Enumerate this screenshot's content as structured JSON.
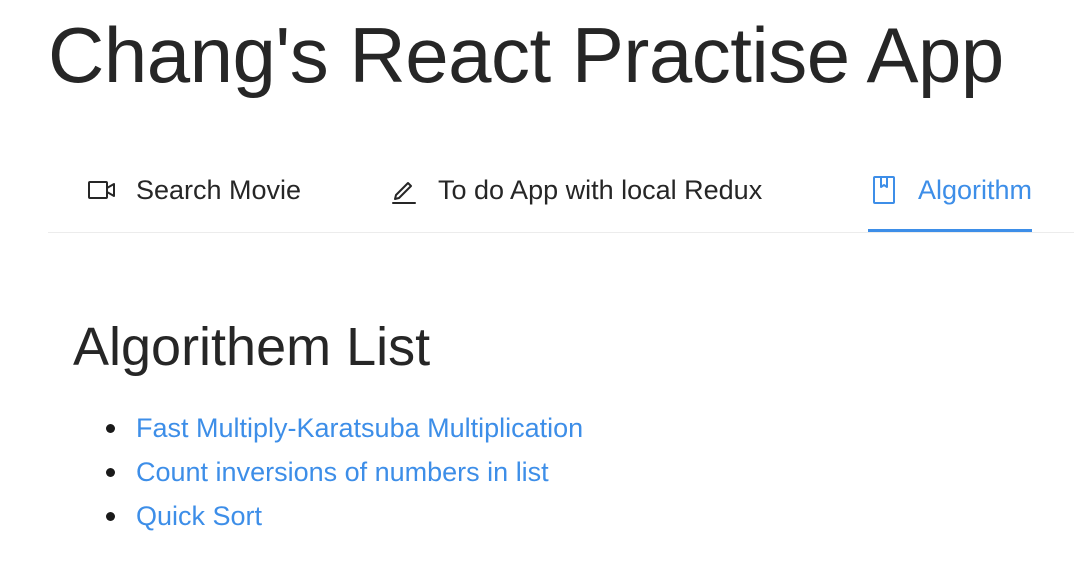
{
  "app": {
    "title": "Chang's React Practise App"
  },
  "nav": {
    "accent_color": "#3d8ee8",
    "items": [
      {
        "label": "Search Movie",
        "icon": "video-camera-icon",
        "active": false
      },
      {
        "label": "To do App with local Redux",
        "icon": "edit-pencil-icon",
        "active": false
      },
      {
        "label": "Algorithm",
        "icon": "book-icon",
        "active": true
      }
    ]
  },
  "main": {
    "section_title": "Algorithem List",
    "algorithms": [
      {
        "label": "Fast Multiply-Karatsuba Multiplication"
      },
      {
        "label": "Count inversions of numbers in list"
      },
      {
        "label": "Quick Sort"
      }
    ]
  }
}
